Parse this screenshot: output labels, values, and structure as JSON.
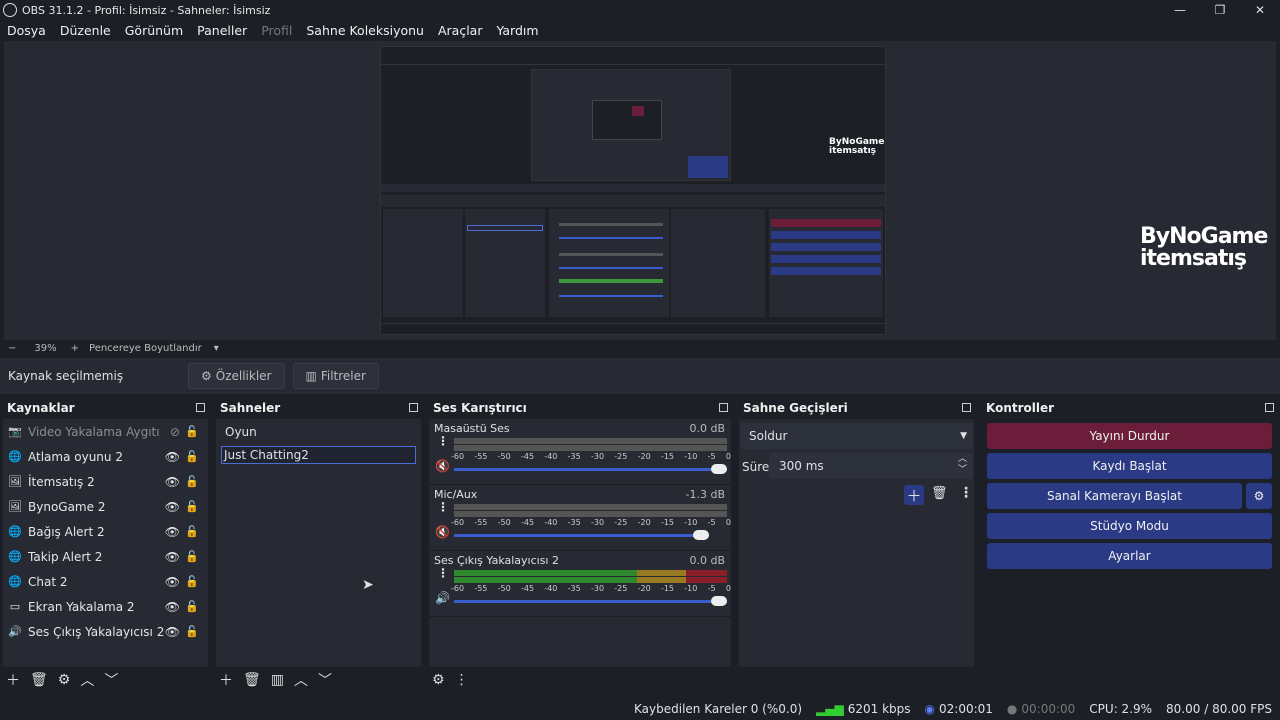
{
  "window": {
    "title": "OBS 31.1.2 - Profil: İsimsiz - Sahneler: İsimsiz",
    "minimize": "—",
    "maximize": "❐",
    "close": "✕"
  },
  "menu": [
    {
      "label": "Dosya",
      "enabled": true
    },
    {
      "label": "Düzenle",
      "enabled": true
    },
    {
      "label": "Görünüm",
      "enabled": true
    },
    {
      "label": "Paneller",
      "enabled": true
    },
    {
      "label": "Profil",
      "enabled": false
    },
    {
      "label": "Sahne Koleksiyonu",
      "enabled": true
    },
    {
      "label": "Araçlar",
      "enabled": true
    },
    {
      "label": "Yardım",
      "enabled": true
    }
  ],
  "preview": {
    "logo_line1": "ByNoGame",
    "logo_line2": "itemsatış"
  },
  "zoom": {
    "minus": "−",
    "value": "39%",
    "plus": "+",
    "fit_label": "Pencereye Boyutlandır"
  },
  "source_bar": {
    "label": "Kaynak seçilmemiş",
    "properties": "Özellikler",
    "filters": "Filtreler"
  },
  "sources": {
    "title": "Kaynaklar",
    "items": [
      {
        "label": "Video Yakalama Aygıtı",
        "icon": "camera-icon",
        "visible": false
      },
      {
        "label": "Atlama oyunu 2",
        "icon": "globe-icon",
        "visible": true
      },
      {
        "label": "İtemsatış 2",
        "icon": "image-icon",
        "visible": true
      },
      {
        "label": "BynoGame 2",
        "icon": "image-icon",
        "visible": true
      },
      {
        "label": "Bağış Alert 2",
        "icon": "globe-icon",
        "visible": true
      },
      {
        "label": "Takip Alert 2",
        "icon": "globe-icon",
        "visible": true
      },
      {
        "label": "Chat 2",
        "icon": "globe-icon",
        "visible": true
      },
      {
        "label": "Ekran Yakalama 2",
        "icon": "monitor-icon",
        "visible": true
      },
      {
        "label": "Ses Çıkış Yakalayıcısı 2",
        "icon": "speaker-icon",
        "visible": true
      }
    ]
  },
  "scenes": {
    "title": "Sahneler",
    "items": [
      "Oyun",
      "Just Chatting2"
    ],
    "selected": 1
  },
  "mixer": {
    "title": "Ses Karıştırıcı",
    "ticks": [
      "-60",
      "-55",
      "-50",
      "-45",
      "-40",
      "-35",
      "-30",
      "-25",
      "-20",
      "-15",
      "-10",
      "-5",
      "0"
    ],
    "channels": [
      {
        "name": "Masaüstü Ses",
        "db": "0.0 dB",
        "muted": true,
        "level": 0.0
      },
      {
        "name": "Mic/Aux",
        "db": "-1.3 dB",
        "muted": true,
        "level": 0.0
      },
      {
        "name": "Ses Çıkış Yakalayıcısı 2",
        "db": "0.0 dB",
        "muted": false,
        "level": 0.68
      }
    ]
  },
  "transitions": {
    "title": "Sahne Geçişleri",
    "type": "Soldur",
    "duration_label": "Süre",
    "duration": "300 ms"
  },
  "controls": {
    "title": "Kontroller",
    "stop_stream": "Yayını Durdur",
    "start_record": "Kaydı Başlat",
    "virtual_cam": "Sanal Kamerayı Başlat",
    "studio_mode": "Stüdyo Modu",
    "settings": "Ayarlar"
  },
  "status": {
    "dropped": "Kaybedilen Kareler 0 (%0.0)",
    "bitrate": "6201 kbps",
    "stream_time": "02:00:01",
    "rec_time": "00:00:00",
    "cpu": "CPU: 2.9%",
    "fps": "80.00 / 80.00 FPS"
  }
}
